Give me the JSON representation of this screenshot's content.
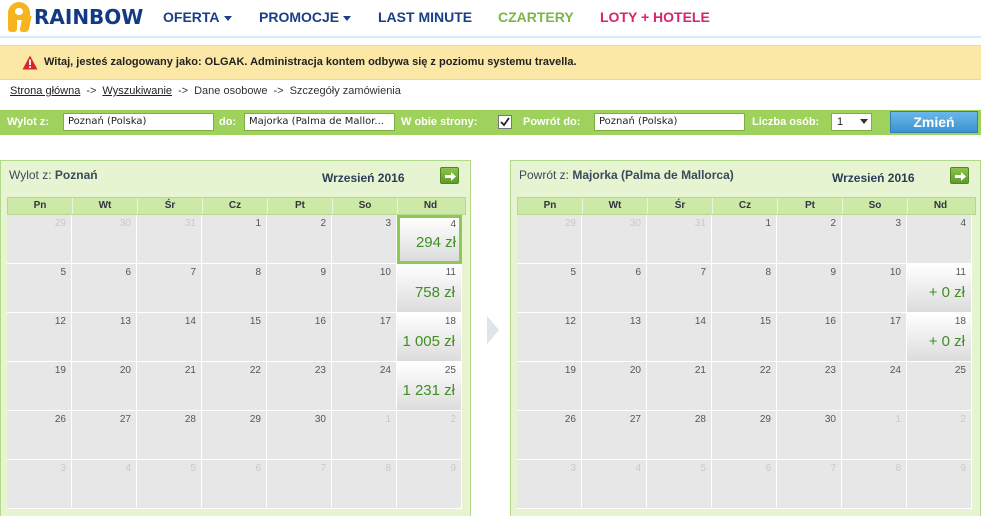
{
  "brand": {
    "name": "RAINBOW"
  },
  "nav": [
    {
      "label": "OFERTA",
      "color": "#1a3f86",
      "has_dropdown": true
    },
    {
      "label": "PROMOCJE",
      "color": "#1a3f86",
      "has_dropdown": true
    },
    {
      "label": "LAST MINUTE",
      "color": "#1a3f86",
      "has_dropdown": false
    },
    {
      "label": "CZARTERY",
      "color": "#7ab648",
      "has_dropdown": false
    },
    {
      "label": "LOTY + HOTELE",
      "color": "#d6246e",
      "has_dropdown": false
    }
  ],
  "notice": {
    "text": "Witaj, jesteś zalogowany jako: OLGAK. Administracja kontem odbywa się z poziomu systemu travella."
  },
  "breadcrumb": {
    "home": "Strona główna",
    "search": "Wyszukiwanie",
    "personal": "Dane osobowe",
    "details": "Szczegóły zamówienia",
    "sep": "->"
  },
  "search": {
    "from_label": "Wylot z:",
    "from_value": "Poznań (Polska)",
    "to_label": "do:",
    "to_value": "Majorka (Palma de Mallor...",
    "both_label": "W obie strony:",
    "both_checked": true,
    "return_label": "Powrót do:",
    "return_value": "Poznań (Polska)",
    "persons_label": "Liczba osób:",
    "persons_value": "1",
    "submit_label": "Zmień"
  },
  "days_of_week": [
    "Pn",
    "Wt",
    "Śr",
    "Cz",
    "Pt",
    "So",
    "Nd"
  ],
  "calendars": [
    {
      "title_prefix": "Wylot z:",
      "title_city": "Poznań",
      "month": "Wrzesień 2016",
      "weeks": [
        [
          {
            "d": "29",
            "o": true
          },
          {
            "d": "30",
            "o": true
          },
          {
            "d": "31",
            "o": true
          },
          {
            "d": "1"
          },
          {
            "d": "2"
          },
          {
            "d": "3"
          },
          {
            "d": "4",
            "p": "294 zł",
            "sel": true
          }
        ],
        [
          {
            "d": "5"
          },
          {
            "d": "6"
          },
          {
            "d": "7"
          },
          {
            "d": "8"
          },
          {
            "d": "9"
          },
          {
            "d": "10"
          },
          {
            "d": "11",
            "p": "758 zł"
          }
        ],
        [
          {
            "d": "12"
          },
          {
            "d": "13"
          },
          {
            "d": "14"
          },
          {
            "d": "15"
          },
          {
            "d": "16"
          },
          {
            "d": "17"
          },
          {
            "d": "18",
            "p": "1 005 zł"
          }
        ],
        [
          {
            "d": "19"
          },
          {
            "d": "20"
          },
          {
            "d": "21"
          },
          {
            "d": "22"
          },
          {
            "d": "23"
          },
          {
            "d": "24"
          },
          {
            "d": "25",
            "p": "1 231 zł"
          }
        ],
        [
          {
            "d": "26"
          },
          {
            "d": "27"
          },
          {
            "d": "28"
          },
          {
            "d": "29"
          },
          {
            "d": "30"
          },
          {
            "d": "1",
            "o": true
          },
          {
            "d": "2",
            "o": true
          }
        ],
        [
          {
            "d": "3",
            "o": true
          },
          {
            "d": "4",
            "o": true
          },
          {
            "d": "5",
            "o": true
          },
          {
            "d": "6",
            "o": true
          },
          {
            "d": "7",
            "o": true
          },
          {
            "d": "8",
            "o": true
          },
          {
            "d": "9",
            "o": true
          }
        ]
      ]
    },
    {
      "title_prefix": "Powrót z:",
      "title_city": "Majorka (Palma de Mallorca)",
      "month": "Wrzesień 2016",
      "weeks": [
        [
          {
            "d": "29",
            "o": true
          },
          {
            "d": "30",
            "o": true
          },
          {
            "d": "31",
            "o": true
          },
          {
            "d": "1"
          },
          {
            "d": "2"
          },
          {
            "d": "3"
          },
          {
            "d": "4"
          }
        ],
        [
          {
            "d": "5"
          },
          {
            "d": "6"
          },
          {
            "d": "7"
          },
          {
            "d": "8"
          },
          {
            "d": "9"
          },
          {
            "d": "10"
          },
          {
            "d": "11",
            "p": "+ 0 zł"
          }
        ],
        [
          {
            "d": "12"
          },
          {
            "d": "13"
          },
          {
            "d": "14"
          },
          {
            "d": "15"
          },
          {
            "d": "16"
          },
          {
            "d": "17"
          },
          {
            "d": "18",
            "p": "+ 0 zł"
          }
        ],
        [
          {
            "d": "19"
          },
          {
            "d": "20"
          },
          {
            "d": "21"
          },
          {
            "d": "22"
          },
          {
            "d": "23"
          },
          {
            "d": "24"
          },
          {
            "d": "25"
          }
        ],
        [
          {
            "d": "26"
          },
          {
            "d": "27"
          },
          {
            "d": "28"
          },
          {
            "d": "29"
          },
          {
            "d": "30"
          },
          {
            "d": "1",
            "o": true
          },
          {
            "d": "2",
            "o": true
          }
        ],
        [
          {
            "d": "3",
            "o": true
          },
          {
            "d": "4",
            "o": true
          },
          {
            "d": "5",
            "o": true
          },
          {
            "d": "6",
            "o": true
          },
          {
            "d": "7",
            "o": true
          },
          {
            "d": "8",
            "o": true
          },
          {
            "d": "9",
            "o": true
          }
        ]
      ]
    }
  ],
  "colors": {
    "accent_green": "#9ed25c",
    "price_green": "#3f8f22",
    "notice_bg": "#fbe8a6",
    "button_blue": "#3c93d0"
  }
}
